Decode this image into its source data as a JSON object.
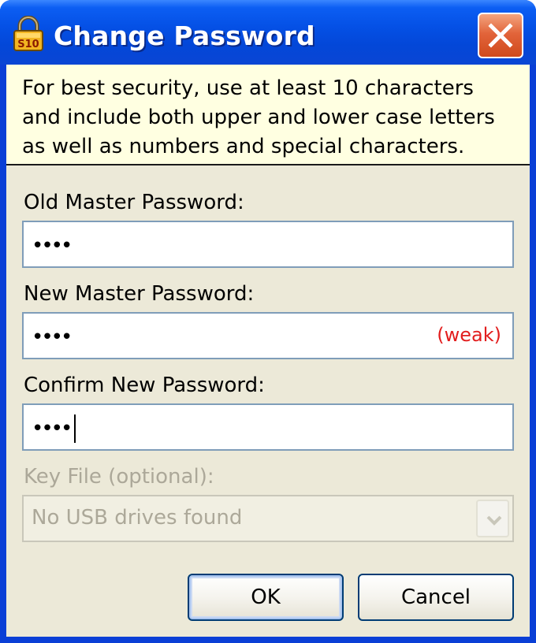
{
  "window": {
    "title": "Change Password",
    "icon": "lock-icon",
    "icon_text": "S10"
  },
  "info": {
    "lines": [
      "For best security, use at least 10 characters",
      "and include both upper and lower case letters",
      "as well as numbers and special characters."
    ]
  },
  "old_password": {
    "label": "Old Master Password:",
    "value": "••••"
  },
  "new_password": {
    "label": "New Master Password:",
    "value": "••••",
    "strength": "(weak)"
  },
  "confirm_password": {
    "label": "Confirm New Password:",
    "value": "••••"
  },
  "key_file": {
    "label": "Key File (optional):",
    "selected": "No USB drives found"
  },
  "buttons": {
    "ok": "OK",
    "cancel": "Cancel"
  },
  "colors": {
    "titlebar": "#0551e6",
    "info_background": "#ffffe1",
    "dialog_background": "#ece9d8",
    "strength_weak": "#e21d1d",
    "close_button": "#e2643a"
  }
}
